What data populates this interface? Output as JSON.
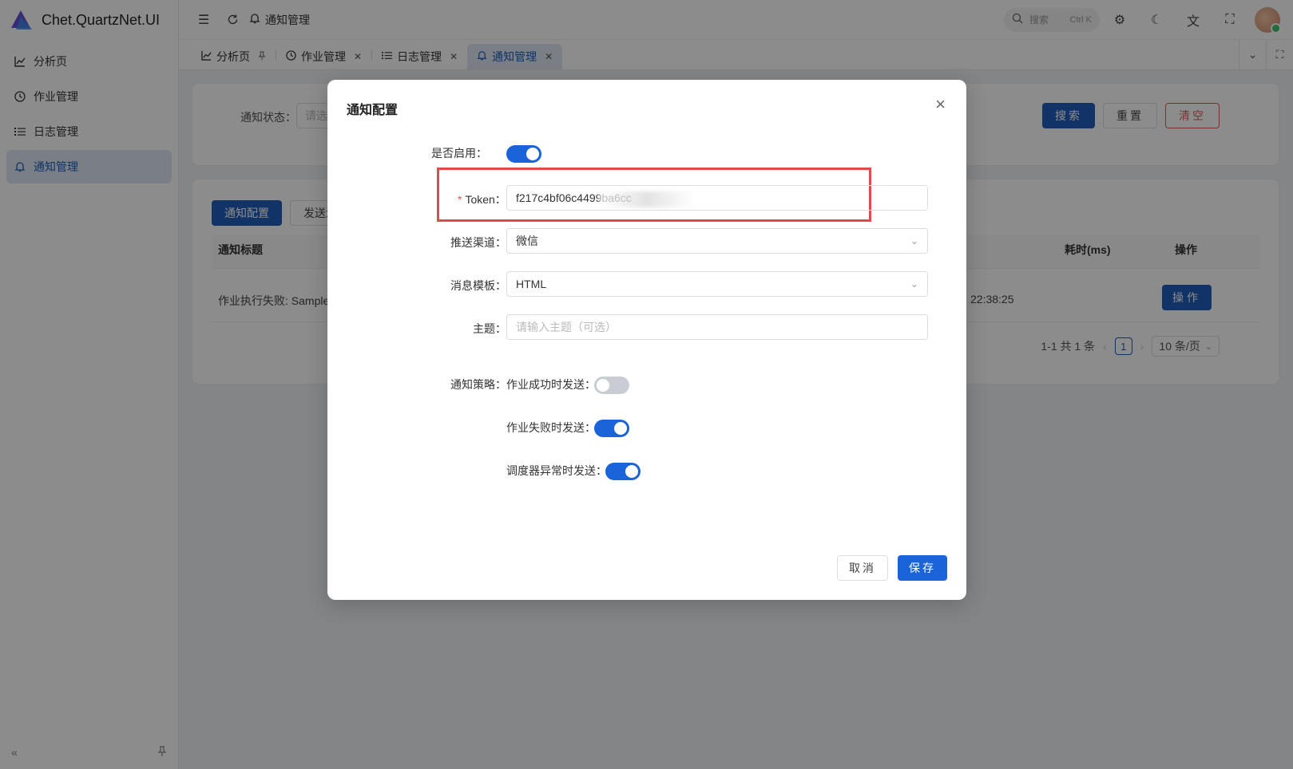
{
  "app": {
    "title": "Chet.QuartzNet.UI"
  },
  "sidebar": {
    "items": [
      {
        "label": "分析页",
        "icon": "chart-icon"
      },
      {
        "label": "作业管理",
        "icon": "clock-icon"
      },
      {
        "label": "日志管理",
        "icon": "list-icon"
      },
      {
        "label": "通知管理",
        "icon": "bell-icon",
        "active": true
      }
    ]
  },
  "header": {
    "breadcrumb": "通知管理",
    "search_placeholder": "搜索",
    "search_shortcut": "Ctrl K"
  },
  "tabs": [
    {
      "label": "分析页",
      "icon": "chart-icon",
      "closable": false
    },
    {
      "label": "作业管理",
      "icon": "clock-icon",
      "closable": true
    },
    {
      "label": "日志管理",
      "icon": "list-icon",
      "closable": true
    },
    {
      "label": "通知管理",
      "icon": "bell-icon",
      "closable": true,
      "active": true
    }
  ],
  "search_panel": {
    "status_label": "通知状态：",
    "status_placeholder": "请选",
    "search_btn": "搜索",
    "reset_btn": "重置",
    "clear_btn": "清空"
  },
  "table_panel": {
    "config_btn": "通知配置",
    "send_btn": "发送测",
    "columns": [
      "通知标题",
      "耗时(ms)",
      "操作"
    ],
    "rows": [
      {
        "title": "作业执行失败: Sample",
        "time": "22:38:25",
        "action": "操作"
      }
    ],
    "pager": {
      "summary": "1-1 共 1 条",
      "current": "1",
      "page_size": "10 条/页"
    }
  },
  "modal": {
    "title": "通知配置",
    "enabled_label": "是否启用：",
    "enabled": true,
    "token_label": "Token：",
    "token_value": "f217c4bf06c4499ba6cc",
    "channel_label": "推送渠道：",
    "channel_value": "微信",
    "template_label": "消息模板：",
    "template_value": "HTML",
    "subject_label": "主题：",
    "subject_placeholder": "请输入主题（可选）",
    "strategy_label": "通知策略：",
    "on_success_label": "作业成功时发送：",
    "on_success": false,
    "on_failure_label": "作业失败时发送：",
    "on_failure": true,
    "on_scheduler_error_label": "调度器异常时发送：",
    "on_scheduler_error": true,
    "cancel_btn": "取消",
    "save_btn": "保存"
  },
  "colors": {
    "primary": "#1f5db8",
    "switch_on": "#1a63d8",
    "danger": "#e05a5a",
    "highlight": "#e24b4b"
  }
}
